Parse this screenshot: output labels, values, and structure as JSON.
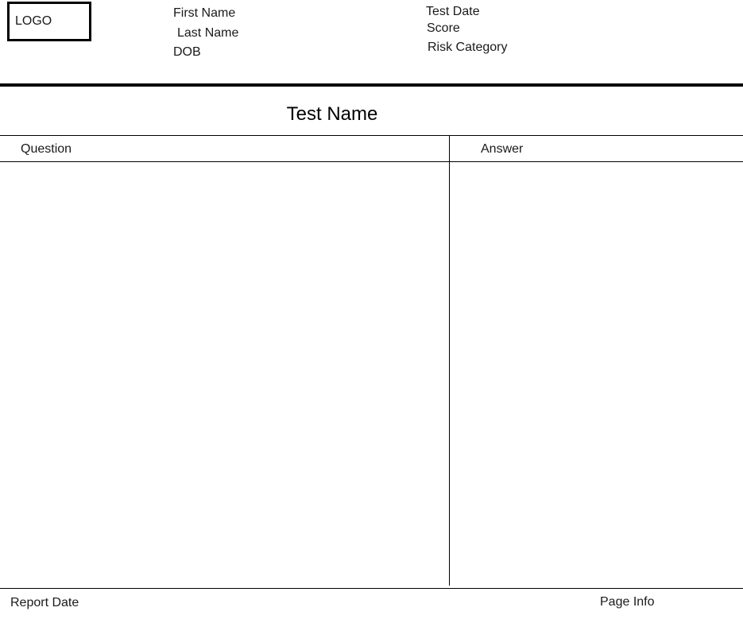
{
  "header": {
    "logo_label": "LOGO",
    "patient": {
      "first_name_label": "First Name",
      "last_name_label": "Last Name",
      "dob_label": "DOB"
    },
    "test_info": {
      "test_date_label": "Test Date",
      "score_label": "Score",
      "risk_category_label": "Risk Category"
    }
  },
  "main": {
    "test_name": "Test Name",
    "table": {
      "columns": [
        "Question",
        "Answer"
      ]
    }
  },
  "footer": {
    "report_date_label": "Report Date",
    "page_info_label": "Page Info"
  }
}
